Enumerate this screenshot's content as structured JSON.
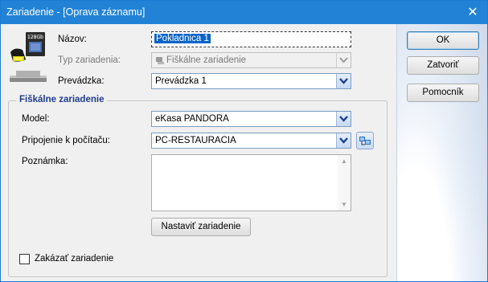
{
  "window": {
    "title": "Zariadenie - [Oprava záznamu]",
    "close_glyph": "✕"
  },
  "form": {
    "name_label": "Názov:",
    "name_value": "Pokladnica 1",
    "type_label": "Typ zariadenia:",
    "type_value": "Fiškálne zariadenie",
    "premises_label": "Prevádzka:",
    "premises_value": "Prevádzka 1"
  },
  "fiscal_group": {
    "title": "Fiškálne zariadenie",
    "model_label": "Model:",
    "model_value": "eKasa PANDORA",
    "connection_label": "Pripojenie k počítaču:",
    "connection_value": "PC-RESTAURACIA",
    "note_label": "Poznámka:",
    "note_value": "",
    "setup_button": "Nastaviť zariadenie"
  },
  "disable_device": {
    "label": "Zakázať zariadenie",
    "checked": false
  },
  "buttons": {
    "ok": "OK",
    "close": "Zatvoriť",
    "help": "Pomocník"
  },
  "icons": {
    "device_image": "card-reader-device-icon",
    "card_text": "128Gb",
    "dropdown": "chevron-down-icon",
    "network": "network-computers-icon"
  },
  "colors": {
    "titlebar": "#2283d6",
    "group_title": "#1e3c8c",
    "selection": "#0a64c8"
  }
}
